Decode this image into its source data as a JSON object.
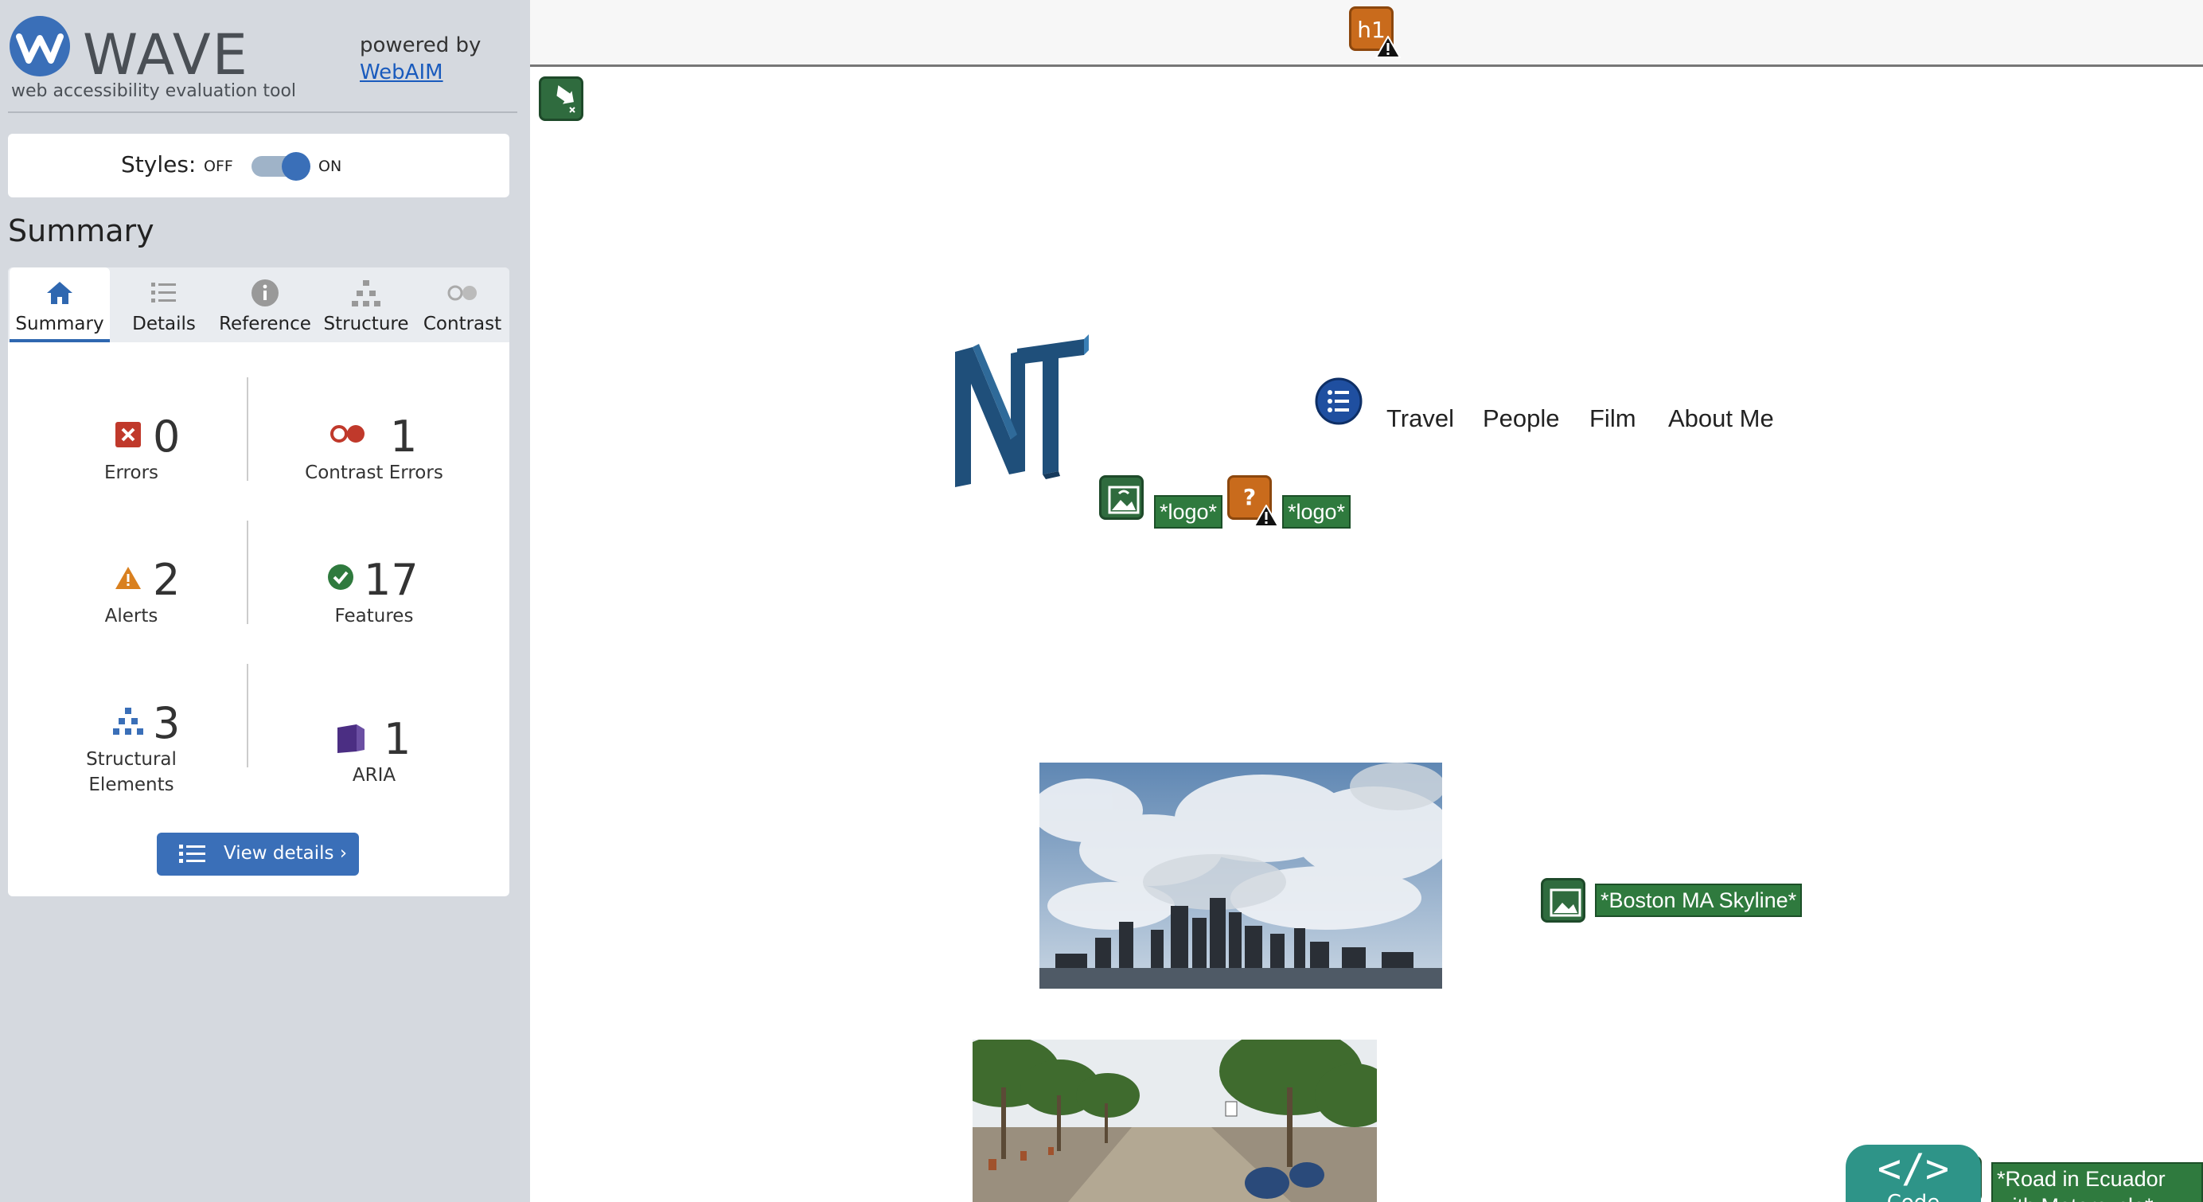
{
  "sidebar": {
    "brand_name": "WAVE",
    "brand_tagline": "web accessibility evaluation tool",
    "powered_by": "powered by",
    "webaim_link": "WebAIM",
    "styles_label": "Styles:",
    "toggle_off": "OFF",
    "toggle_on": "ON",
    "summary_title": "Summary",
    "tabs": [
      {
        "label": "Summary",
        "icon": "home-icon"
      },
      {
        "label": "Details",
        "icon": "list-icon"
      },
      {
        "label": "Reference",
        "icon": "info-icon"
      },
      {
        "label": "Structure",
        "icon": "hierarchy-icon"
      },
      {
        "label": "Contrast",
        "icon": "contrast-icon"
      }
    ],
    "stats": {
      "errors": {
        "count": "0",
        "label": "Errors"
      },
      "contrast_errors": {
        "count": "1",
        "label": "Contrast Errors"
      },
      "alerts": {
        "count": "2",
        "label": "Alerts"
      },
      "features": {
        "count": "17",
        "label": "Features"
      },
      "structural": {
        "count": "3",
        "label_line1": "Structural",
        "label_line2": "Elements"
      },
      "aria": {
        "count": "1",
        "label": "ARIA"
      }
    },
    "view_details": "View details ›"
  },
  "page": {
    "h1_badge": "h1",
    "nav": [
      "Travel",
      "People",
      "Film",
      "About Me"
    ],
    "logo_alt_1": "*logo*",
    "logo_alt_2": "*logo*",
    "image_labels": {
      "boston": "*Boston MA Skyline*",
      "ecuador": "*Road in Ecuador with Motorcycle*"
    },
    "code_button": {
      "glyph": "</>",
      "label": "Code"
    }
  },
  "colors": {
    "accent_blue": "#3a6fb8",
    "error_red": "#c0392b",
    "alert_orange": "#d9801f",
    "feature_green": "#2f7a3e",
    "aria_purple": "#4b2e83",
    "code_teal": "#2e9488"
  }
}
